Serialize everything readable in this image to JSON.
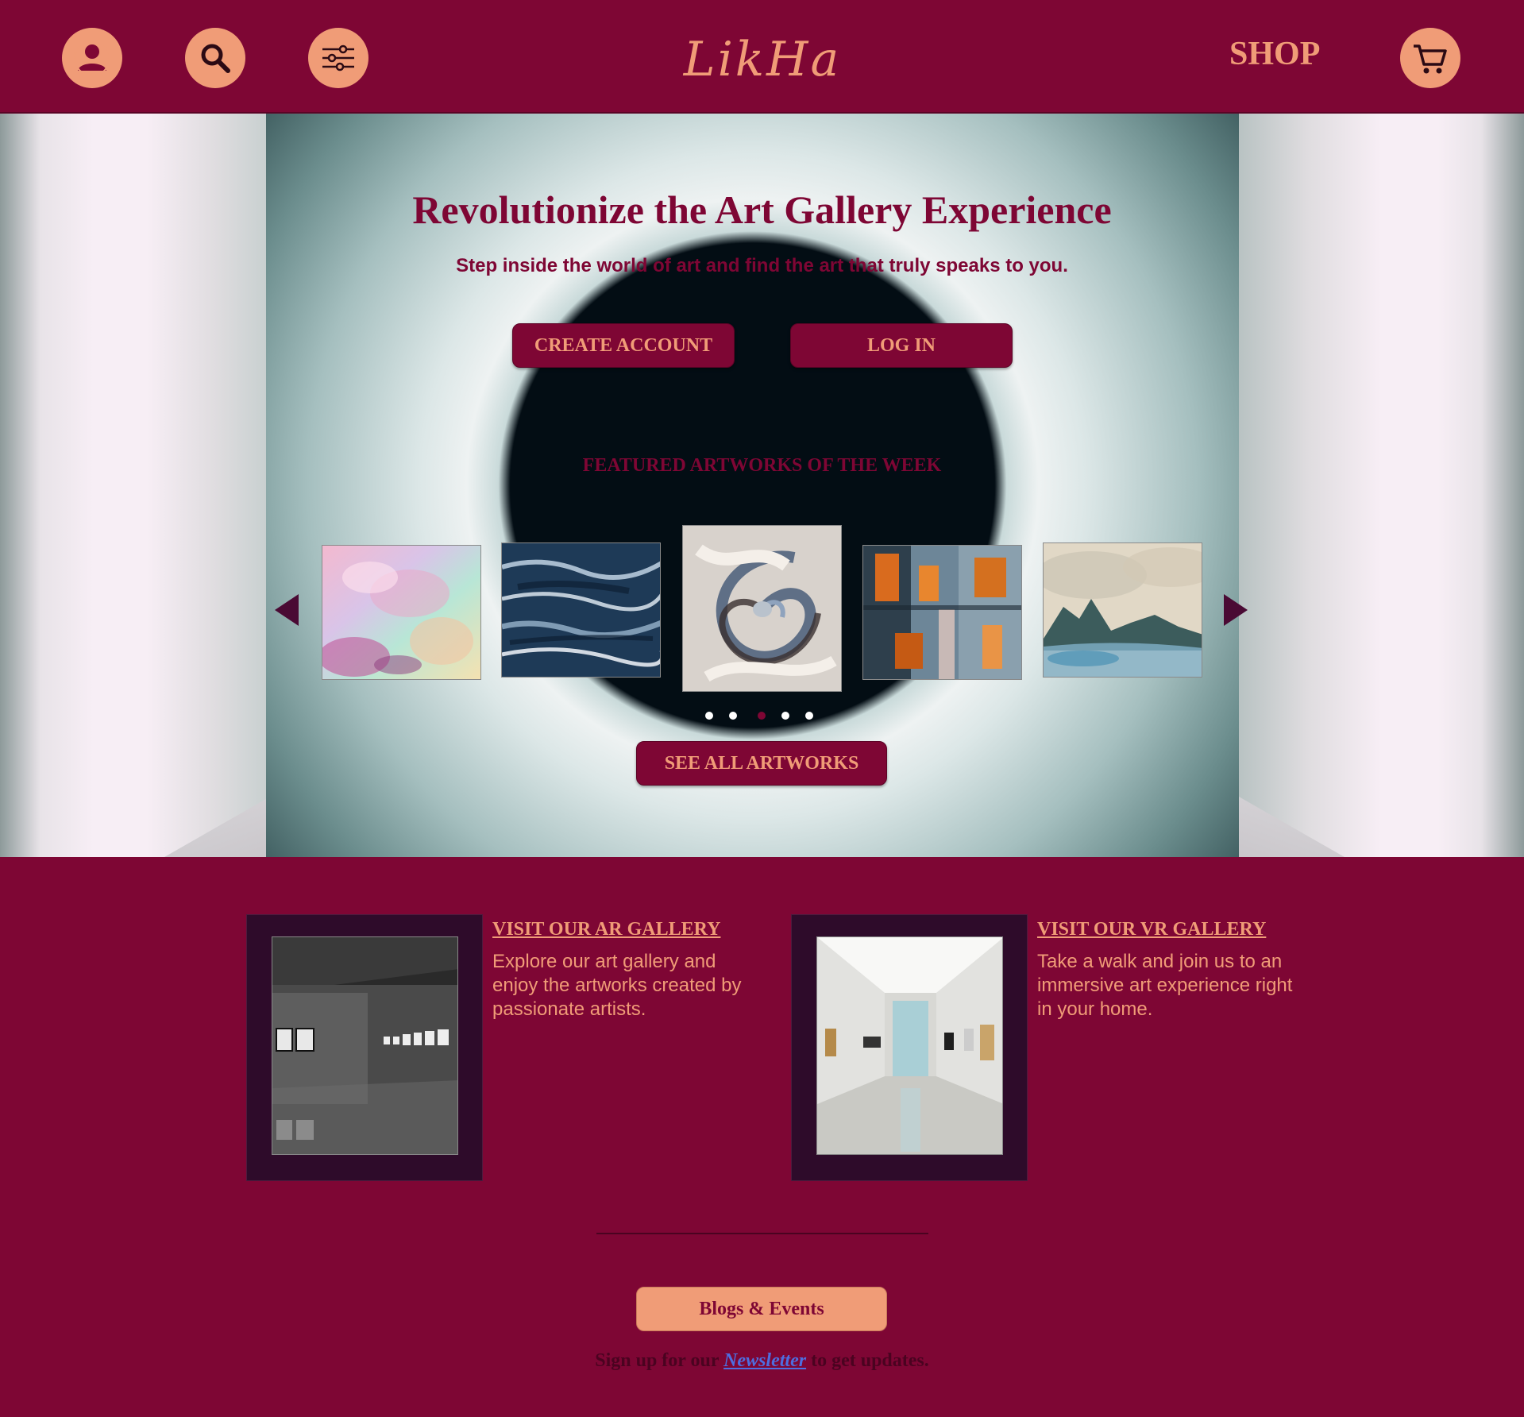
{
  "header": {
    "logo": "LikHa",
    "shop_label": "SHOP",
    "icons": [
      "user-icon",
      "search-icon",
      "filter-icon",
      "cart-icon"
    ]
  },
  "hero": {
    "title": "Revolutionize the Art Gallery Experience",
    "subtitle": "Step inside the world of art and find the art that truly speaks to you.",
    "create_account_label": "CREATE ACCOUNT",
    "login_label": "LOG IN",
    "featured_heading": "FEATURED ARTWORKS OF THE WEEK",
    "carousel": {
      "total": 5,
      "active_index": 3
    },
    "see_all_label": "SEE ALL ARTWORKS"
  },
  "galleries": {
    "ar": {
      "title": "VISIT OUR AR GALLERY",
      "text": "Explore our art gallery and enjoy the artworks created by passionate artists."
    },
    "vr": {
      "title": "VISIT OUR VR GALLERY",
      "text": "Take a walk and join us to an immersive art experience right in your home."
    }
  },
  "footer": {
    "blogs_label": "Blogs & Events",
    "newsletter_prefix": "Sign up for our ",
    "newsletter_link": "Newsletter",
    "newsletter_suffix": " to get updates."
  },
  "colors": {
    "brand": "#7e0634",
    "accent": "#f09c77",
    "card_bg": "#2e0b2a",
    "link": "#4e6ee0"
  }
}
